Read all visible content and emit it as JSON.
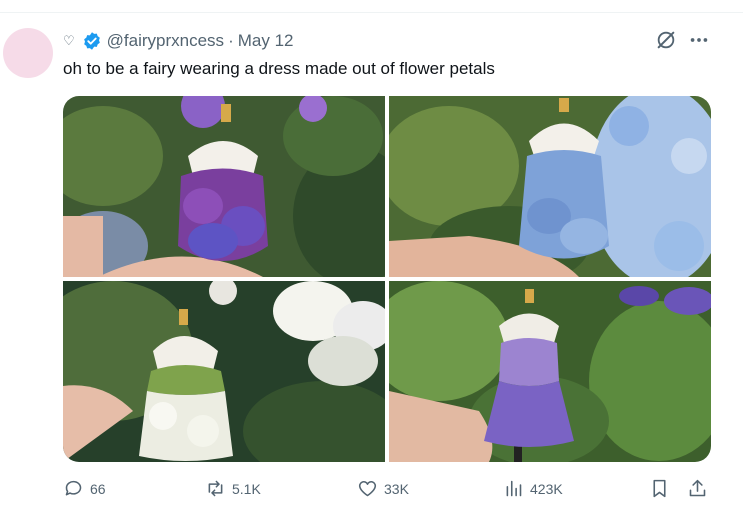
{
  "tweet": {
    "handle": "@fairyprxncess",
    "separator": "·",
    "date": "May 12",
    "name_decoration": "♡",
    "text": "oh to be a fairy wearing a dress made out of flower petals"
  },
  "actions": {
    "replies": "66",
    "retweets": "5.1K",
    "likes": "33K",
    "views": "423K"
  },
  "icons": {
    "verified": "verified-badge-icon",
    "grok": "grok-icon",
    "more": "more-options-icon",
    "reply": "reply-icon",
    "retweet": "retweet-icon",
    "like": "like-icon",
    "views": "views-icon",
    "bookmark": "bookmark-icon",
    "share": "share-icon"
  },
  "colors": {
    "text": "#0f1419",
    "muted": "#536471",
    "verified": "#1d9bf0",
    "avatar": "#f6dbe8"
  },
  "media": {
    "photos": [
      {
        "dress": "purple hydrangea petal dress"
      },
      {
        "dress": "blue hydrangea petal dress"
      },
      {
        "dress": "white and green petal dress"
      },
      {
        "dress": "violet petal dress"
      }
    ]
  }
}
